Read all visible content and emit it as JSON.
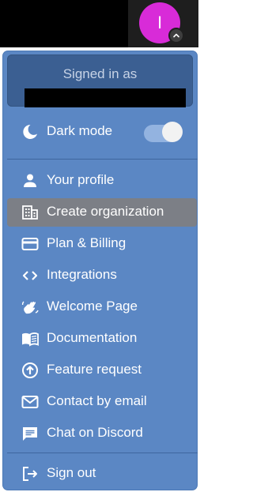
{
  "header": {
    "avatar_initial": "I"
  },
  "menu": {
    "signed_in_label": "Signed in as",
    "dark_mode": {
      "label": "Dark mode",
      "enabled": true
    },
    "items": [
      {
        "label": "Your profile",
        "icon": "person-icon"
      },
      {
        "label": "Create organization",
        "icon": "building-icon",
        "highlighted": true
      },
      {
        "label": "Plan & Billing",
        "icon": "credit-card-icon"
      },
      {
        "label": "Integrations",
        "icon": "code-icon"
      },
      {
        "label": "Welcome Page",
        "icon": "waving-hand-icon"
      },
      {
        "label": "Documentation",
        "icon": "book-icon"
      },
      {
        "label": "Feature request",
        "icon": "arrow-up-circle-icon"
      },
      {
        "label": "Contact by email",
        "icon": "mail-icon"
      },
      {
        "label": "Chat on Discord",
        "icon": "chat-icon"
      }
    ],
    "sign_out_label": "Sign out"
  },
  "colors": {
    "avatar": "#d82bd8",
    "menu_background": "#5b87c4",
    "signed_box": "#3b5f92",
    "highlight": "#7c7f86"
  }
}
